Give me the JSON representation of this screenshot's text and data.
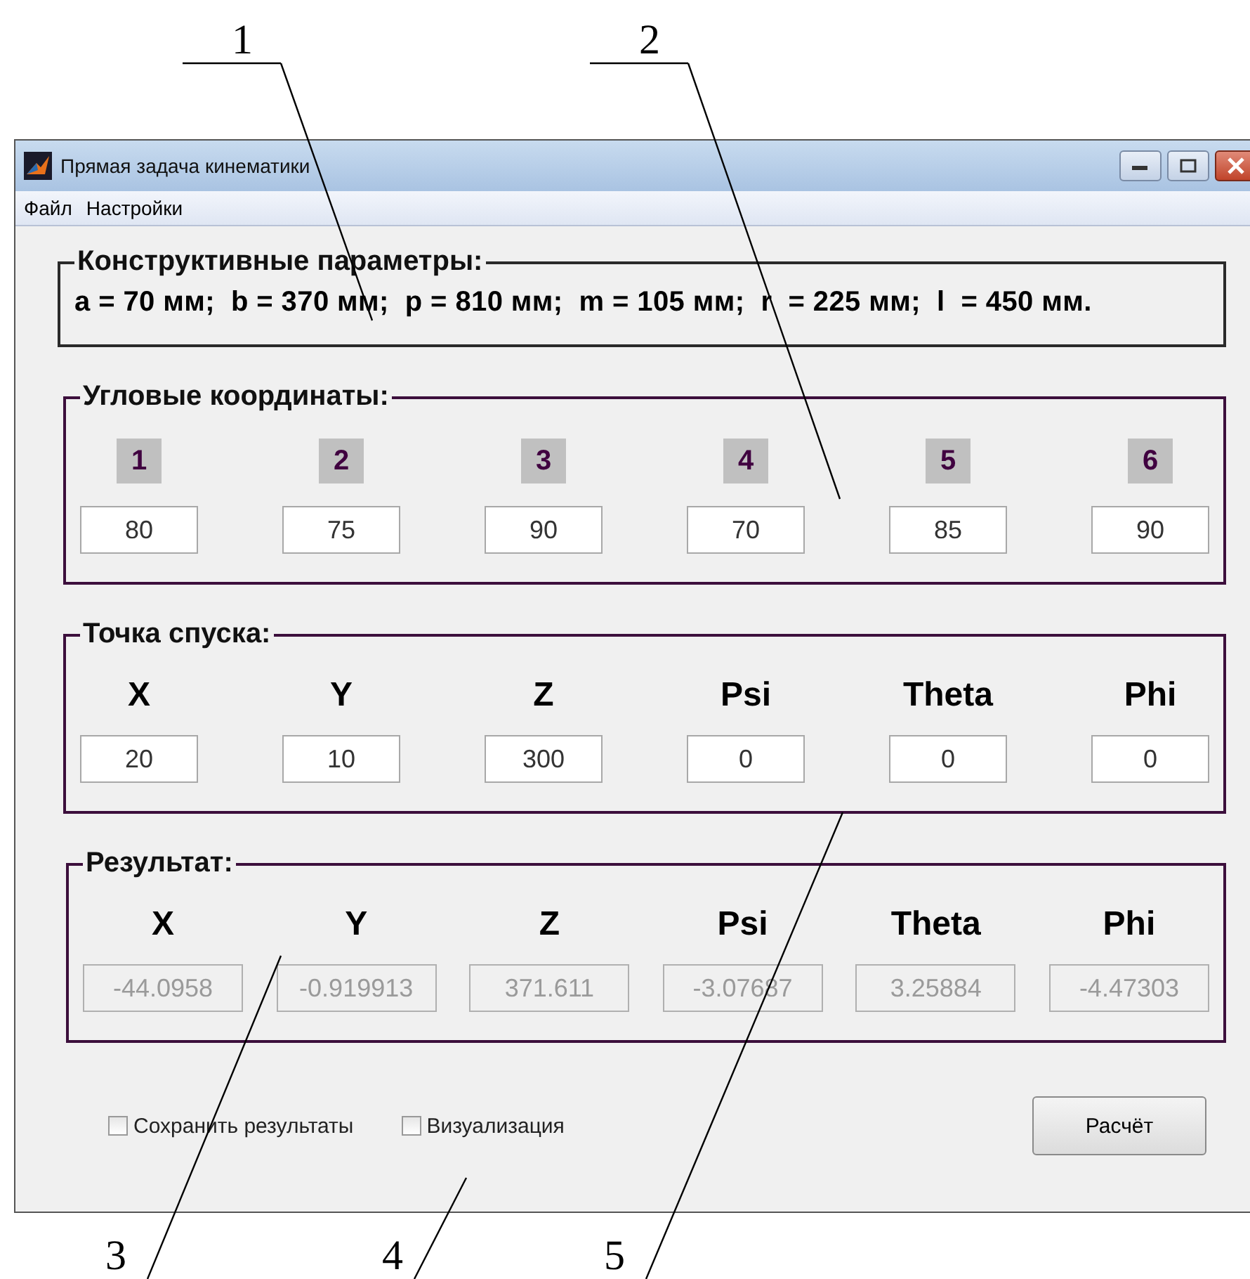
{
  "window": {
    "title": "Прямая задача кинематики"
  },
  "menu": [
    "Файл",
    "Настройки"
  ],
  "parameters": {
    "title": "Конструктивные параметры:",
    "text": "a = 70 мм;  b = 370 мм;  p = 810 мм;  m = 105 мм;  r  = 225 мм;  l  = 450 мм."
  },
  "angles": {
    "title": "Угловые координаты:",
    "items": [
      {
        "label": "1",
        "value": "80"
      },
      {
        "label": "2",
        "value": "75"
      },
      {
        "label": "3",
        "value": "90"
      },
      {
        "label": "4",
        "value": "70"
      },
      {
        "label": "5",
        "value": "85"
      },
      {
        "label": "6",
        "value": "90"
      }
    ]
  },
  "target": {
    "title": "Точка спуска:",
    "items": [
      {
        "label": "X",
        "value": "20",
        "disabled": false
      },
      {
        "label": "Y",
        "value": "10",
        "disabled": false
      },
      {
        "label": "Z",
        "value": "300",
        "disabled": false
      },
      {
        "label": "Psi",
        "value": "0",
        "disabled": false
      },
      {
        "label": "Theta",
        "value": "0",
        "disabled": false
      },
      {
        "label": "Phi",
        "value": "0",
        "disabled": false
      }
    ]
  },
  "result": {
    "title": "Результат:",
    "items": [
      {
        "label": "X",
        "value": "-44.0958",
        "disabled": true
      },
      {
        "label": "Y",
        "value": "-0.919913",
        "disabled": true
      },
      {
        "label": "Z",
        "value": "371.611",
        "disabled": true
      },
      {
        "label": "Psi",
        "value": "-3.07687",
        "disabled": true
      },
      {
        "label": "Theta",
        "value": "3.25884",
        "disabled": true
      },
      {
        "label": "Phi",
        "value": "-4.47303",
        "disabled": true
      }
    ]
  },
  "checkboxes": [
    {
      "label": "Сохранить результаты",
      "checked": false
    },
    {
      "label": "Визуализация",
      "checked": false
    }
  ],
  "button": "Расчёт",
  "callouts": [
    "1",
    "2",
    "3",
    "4",
    "5"
  ]
}
